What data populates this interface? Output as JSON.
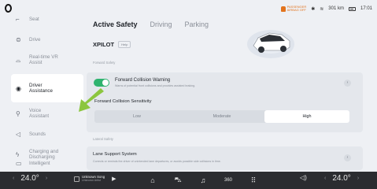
{
  "status": {
    "airbag_line1": "PASSENGER",
    "airbag_line2": "AIRBAG OFF",
    "range": "301 km",
    "time": "17:01"
  },
  "sidebar": {
    "items": [
      {
        "label": "Seat",
        "icon": "seat-icon",
        "glyph": "⌐"
      },
      {
        "label": "Drive",
        "icon": "steering-wheel-icon",
        "glyph": "⊜"
      },
      {
        "label": "Real-time VR\nAssist",
        "icon": "vr-assist-icon",
        "glyph": "⌓"
      },
      {
        "label": "Driver\nAssistance",
        "icon": "driver-assistance-icon",
        "glyph": "◉"
      },
      {
        "label": "Voice\nAssistant",
        "icon": "voice-assistant-icon",
        "glyph": "⚲"
      },
      {
        "label": "Sounds",
        "icon": "speaker-icon",
        "glyph": "◁"
      },
      {
        "label": "Charging and\nDischarging",
        "icon": "charging-icon",
        "glyph": "ϟ"
      },
      {
        "label": "Intelligent",
        "icon": "intelligent-icon",
        "glyph": "▭"
      }
    ]
  },
  "tabs": [
    "Active Safety",
    "Driving",
    "Parking"
  ],
  "xpilot": {
    "label": "XPILOT",
    "help": "Help"
  },
  "sections": {
    "forward": "Forward Safety",
    "lateral": "Lateral Safety"
  },
  "fcw": {
    "title": "Forward Collision Warning",
    "desc": "Warns of potential front collisions and provides assisted braking.",
    "enabled": true
  },
  "sensitivity": {
    "title": "Forward Collision Sensitivity",
    "options": [
      "Low",
      "Moderate",
      "High"
    ],
    "selected": "High"
  },
  "lss": {
    "title": "Lane Support System",
    "desc": "Corrects or reminds the driver of unintended lane departures, or avoids possible side collisions in time."
  },
  "bottom": {
    "temp_left": "24.0°",
    "temp_right": "24.0°",
    "song": "Unknown Song",
    "artist": "Unknown Artist",
    "dock_icons": [
      "home-icon",
      "car-icon",
      "music-icon",
      "camera-360-icon",
      "apps-grid-icon"
    ],
    "dock_360_label": "360"
  },
  "colors": {
    "accent_green": "#2fb36f",
    "warning_orange": "#e2731d",
    "arrow_green": "#8cc63f"
  }
}
